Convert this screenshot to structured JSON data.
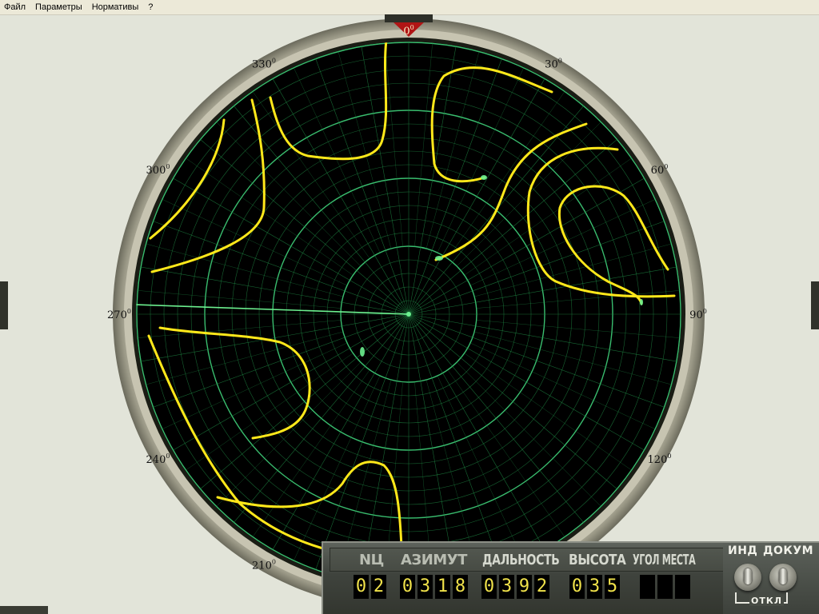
{
  "menu": {
    "items": [
      "Файл",
      "Параметры",
      "Нормативы",
      "?"
    ]
  },
  "scope": {
    "bearing_labels": [
      {
        "deg": 0,
        "text": "0",
        "sup": "0"
      },
      {
        "deg": 30,
        "text": "30",
        "sup": "0"
      },
      {
        "deg": 60,
        "text": "60",
        "sup": "0"
      },
      {
        "deg": 90,
        "text": "90",
        "sup": "0"
      },
      {
        "deg": 120,
        "text": "120",
        "sup": "0"
      },
      {
        "deg": 210,
        "text": "210",
        "sup": "0"
      },
      {
        "deg": 240,
        "text": "240",
        "sup": "0"
      },
      {
        "deg": 270,
        "text": "270",
        "sup": "0"
      },
      {
        "deg": 300,
        "text": "300",
        "sup": "0"
      },
      {
        "deg": 330,
        "text": "330",
        "sup": "0"
      }
    ],
    "colors": {
      "screen": "#000000",
      "grid": "#1f8a45",
      "grid_bright": "#3fd27a",
      "contour": "#ffe81a",
      "sweep": "#6cf08f",
      "bezel": "#c9c6b4",
      "north_marker": "#b01515"
    },
    "sweep_bearing_deg": 272
  },
  "panel": {
    "labels": {
      "nc": "NЦ",
      "azimuth": "АЗИМУТ",
      "range": "ДАЛЬНОСТЬ",
      "height": "ВЫСОТА",
      "elevation": "УГОЛ МЕСТА"
    },
    "values": {
      "nc": "02",
      "azimuth": "0318",
      "range": "0392",
      "height": "035",
      "elevation": ""
    },
    "switches": {
      "ind_label": "ИНД",
      "doc_label": "ДОКУМ",
      "off_label": "ОТКЛ"
    },
    "colors": {
      "digits": "#f0e24a",
      "label": "#b9bdb2"
    }
  }
}
